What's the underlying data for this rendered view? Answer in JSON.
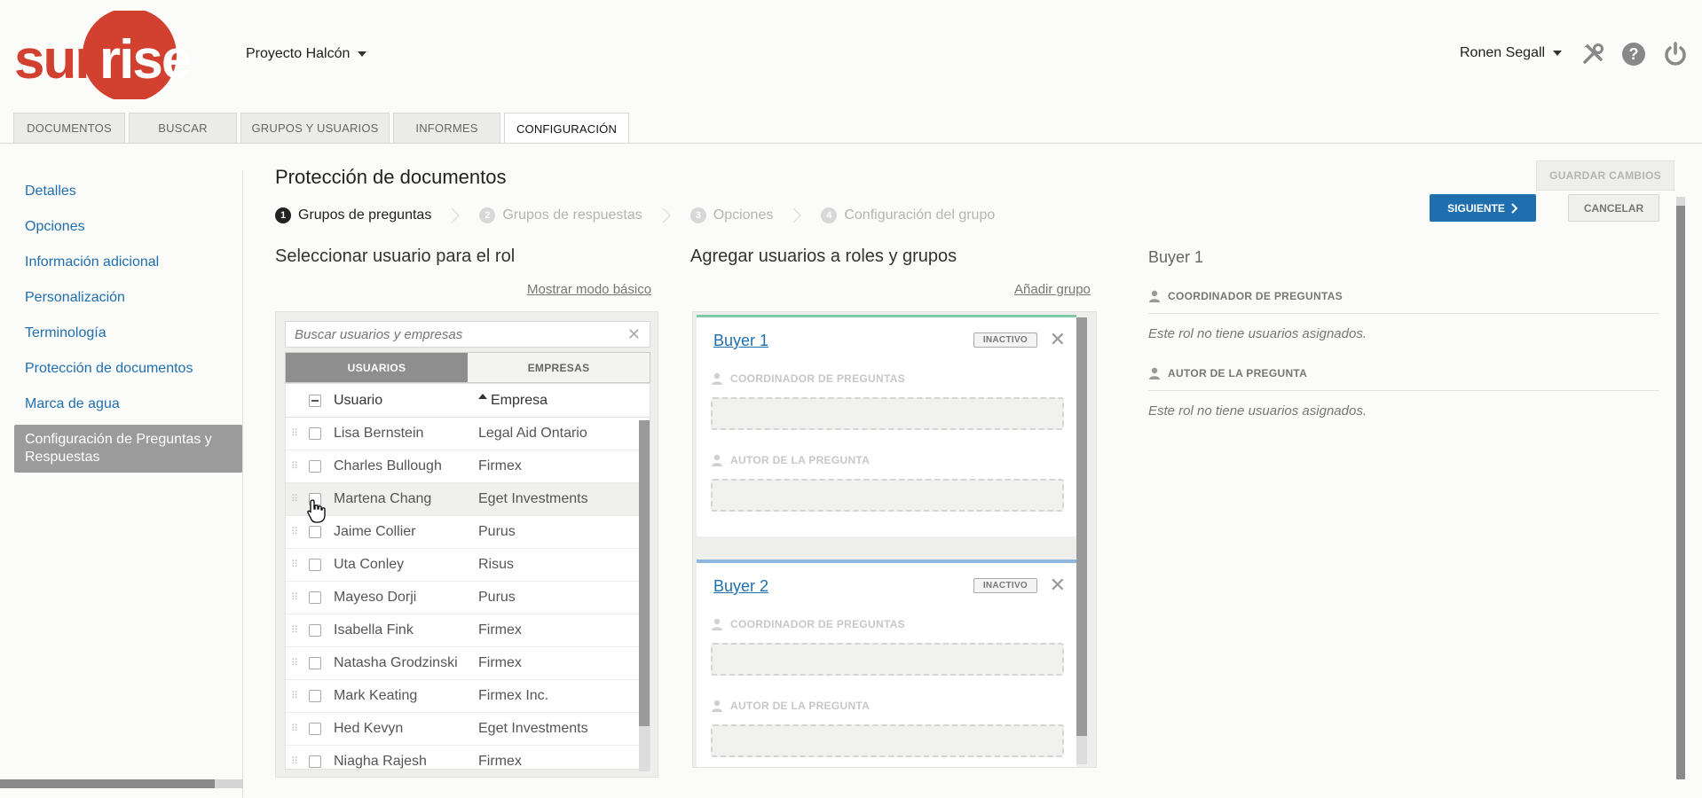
{
  "header": {
    "logo_text": "sunrise",
    "project": "Proyecto Halcón",
    "user": "Ronen Segall",
    "icons": [
      "tools-icon",
      "help-icon",
      "power-icon"
    ]
  },
  "tabs": [
    {
      "label": "DOCUMENTOS",
      "active": false
    },
    {
      "label": "BUSCAR",
      "active": false
    },
    {
      "label": "GRUPOS Y USUARIOS",
      "active": false
    },
    {
      "label": "INFORMES",
      "active": false
    },
    {
      "label": "CONFIGURACIÓN",
      "active": true
    }
  ],
  "sidebar": {
    "items": [
      {
        "label": "Detalles"
      },
      {
        "label": "Opciones"
      },
      {
        "label": "Información adicional"
      },
      {
        "label": "Personalización"
      },
      {
        "label": "Terminología"
      },
      {
        "label": "Protección de documentos"
      },
      {
        "label": "Marca de agua"
      },
      {
        "label": "Configuración de Preguntas y Respuestas",
        "active": true
      }
    ]
  },
  "main": {
    "title": "Protección de documentos",
    "steps": [
      {
        "num": "1",
        "label": "Grupos de preguntas",
        "active": true
      },
      {
        "num": "2",
        "label": "Grupos de respuestas",
        "active": false
      },
      {
        "num": "3",
        "label": "Opciones",
        "active": false
      },
      {
        "num": "4",
        "label": "Configuración del grupo",
        "active": false
      }
    ],
    "save_label": "GUARDAR CAMBIOS",
    "next_label": "SIGUIENTE",
    "cancel_label": "CANCELAR"
  },
  "select_users": {
    "title": "Seleccionar usuario para el rol",
    "basic_mode_link": "Mostrar modo básico",
    "search_placeholder": "Buscar usuarios y empresas",
    "segments": [
      "USUARIOS",
      "EMPRESAS"
    ],
    "columns": [
      "Usuario",
      "Empresa"
    ],
    "rows": [
      {
        "user": "Lisa Bernstein",
        "company": "Legal Aid Ontario"
      },
      {
        "user": "Charles Bullough",
        "company": "Firmex"
      },
      {
        "user": "Martena Chang",
        "company": "Eget Investments"
      },
      {
        "user": "Jaime Collier",
        "company": "Purus"
      },
      {
        "user": "Uta Conley",
        "company": "Risus"
      },
      {
        "user": "Mayeso Dorji",
        "company": "Purus"
      },
      {
        "user": "Isabella Fink",
        "company": "Firmex"
      },
      {
        "user": "Natasha Grodzinski",
        "company": "Firmex"
      },
      {
        "user": "Mark Keating",
        "company": "Firmex Inc."
      },
      {
        "user": "Hed Kevyn",
        "company": "Eget Investments"
      },
      {
        "user": "Niagha Rajesh",
        "company": "Firmex"
      }
    ]
  },
  "add_users": {
    "title": "Agregar usuarios a roles y grupos",
    "add_group_link": "Añadir grupo",
    "groups": [
      {
        "name": "Buyer 1",
        "status": "INACTIVO",
        "roles": [
          "COORDINADOR DE PREGUNTAS",
          "AUTOR DE LA PREGUNTA"
        ],
        "accent": "#7ccaa6"
      },
      {
        "name": "Buyer 2",
        "status": "INACTIVO",
        "roles": [
          "COORDINADOR DE PREGUNTAS",
          "AUTOR DE LA PREGUNTA"
        ],
        "accent": "#8fb8de"
      }
    ]
  },
  "details": {
    "title": "Buyer 1",
    "roles": [
      {
        "label": "COORDINADOR DE PREGUNTAS",
        "empty": "Este rol no tiene usuarios asignados."
      },
      {
        "label": "AUTOR DE LA PREGUNTA",
        "empty": "Este rol no tiene usuarios asignados."
      }
    ]
  },
  "colors": {
    "brand": "#d2402f",
    "link": "#1f6fae",
    "primary_button": "#1f6fae"
  }
}
